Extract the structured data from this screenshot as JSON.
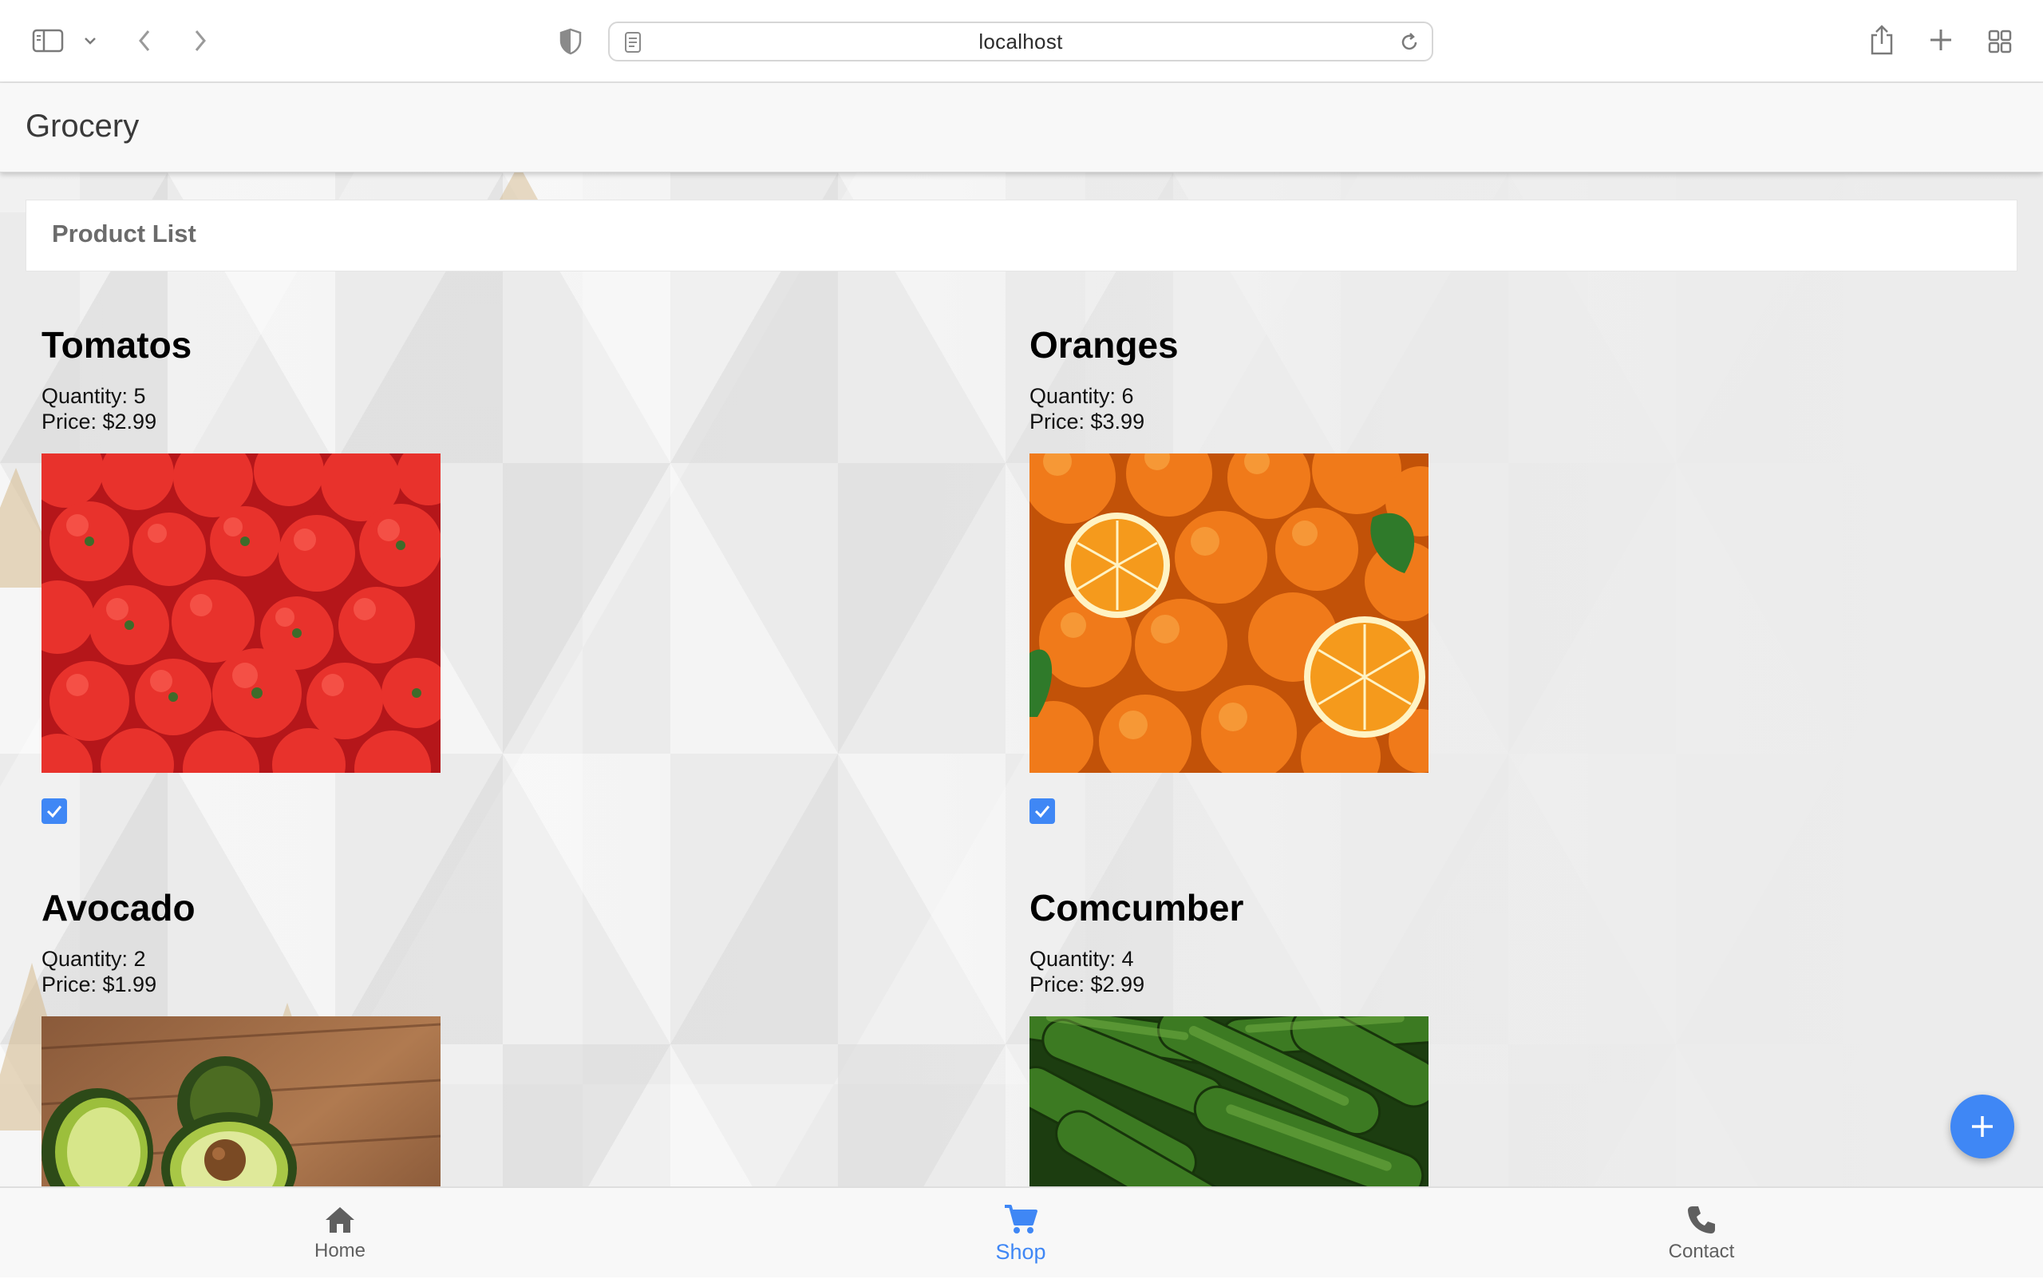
{
  "browser": {
    "url": "localhost",
    "icons": [
      "sidebar-icon",
      "chevron-down-icon",
      "back-icon",
      "forward-icon",
      "privacy-shield-icon",
      "page-icon",
      "reload-icon",
      "share-icon",
      "new-tab-icon",
      "tab-overview-icon"
    ]
  },
  "app": {
    "title": "Grocery"
  },
  "list": {
    "heading": "Product List"
  },
  "products": [
    {
      "name": "Tomatos",
      "quantity": "Quantity: 5",
      "price": "Price: $2.99",
      "checked": true,
      "image": "tomatoes-photo"
    },
    {
      "name": "Oranges",
      "quantity": "Quantity: 6",
      "price": "Price: $3.99",
      "checked": true,
      "image": "oranges-photo"
    },
    {
      "name": "Avocado",
      "quantity": "Quantity: 2",
      "price": "Price: $1.99",
      "image": "avocado-photo"
    },
    {
      "name": "Comcumber",
      "quantity": "Quantity: 4",
      "price": "Price: $2.99",
      "image": "cucumbers-photo"
    }
  ],
  "fab": {
    "icon": "plus-icon"
  },
  "tabs": [
    {
      "label": "Home",
      "icon": "home-icon",
      "active": false
    },
    {
      "label": "Shop",
      "icon": "cart-icon",
      "active": true
    },
    {
      "label": "Contact",
      "icon": "phone-icon",
      "active": false
    }
  ],
  "colors": {
    "accent": "#3f87f5",
    "header_bg": "#f8f8f8",
    "tab_inactive": "#5f5f5f"
  }
}
